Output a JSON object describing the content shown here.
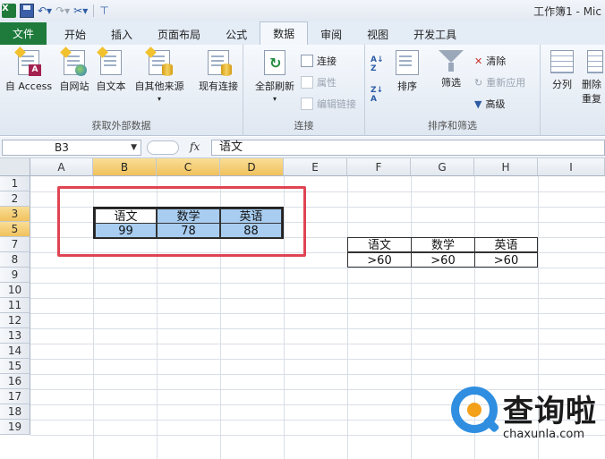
{
  "window": {
    "title": "工作簿1 - Mic"
  },
  "tabs": [
    {
      "label": "文件"
    },
    {
      "label": "开始"
    },
    {
      "label": "插入"
    },
    {
      "label": "页面布局"
    },
    {
      "label": "公式"
    },
    {
      "label": "数据",
      "active": true
    },
    {
      "label": "审阅"
    },
    {
      "label": "视图"
    },
    {
      "label": "开发工具"
    }
  ],
  "ribbon": {
    "external": {
      "label": "获取外部数据",
      "access": "自 Access",
      "web": "自网站",
      "text": "自文本",
      "other": "自其他来源",
      "existing": "现有连接"
    },
    "connections": {
      "label": "连接",
      "refresh_all": "全部刷新",
      "connections": "连接",
      "properties": "属性",
      "edit_links": "编辑链接"
    },
    "sort_filter": {
      "label": "排序和筛选",
      "sort": "排序",
      "filter": "筛选",
      "clear": "清除",
      "reapply": "重新应用",
      "advanced": "高级"
    },
    "tools": {
      "split": "分列",
      "remove": "删除",
      "remove2": "重复"
    }
  },
  "formula_bar": {
    "name_box": "B3",
    "fx": "fx",
    "content": "语文"
  },
  "columns": [
    "A",
    "B",
    "C",
    "D",
    "E",
    "F",
    "G",
    "H",
    "I"
  ],
  "rows": [
    "1",
    "2",
    "3",
    "5",
    "7",
    "8",
    "9",
    "10",
    "11",
    "12",
    "13",
    "14",
    "15",
    "16",
    "17",
    "18",
    "19"
  ],
  "table1": {
    "headers": [
      "语文",
      "数学",
      "英语"
    ],
    "values": [
      "99",
      "78",
      "88"
    ]
  },
  "table2": {
    "headers": [
      "语文",
      "数学",
      "英语"
    ],
    "values": [
      ">60",
      ">60",
      ">60"
    ]
  },
  "watermark": {
    "text": "查询啦",
    "url": "chaxunla.com"
  },
  "colors": {
    "file_tab": "#1e7b3c",
    "selection": "#a8cdf0",
    "highlight_box": "#e04452",
    "header_selected": "#f1c15c"
  }
}
